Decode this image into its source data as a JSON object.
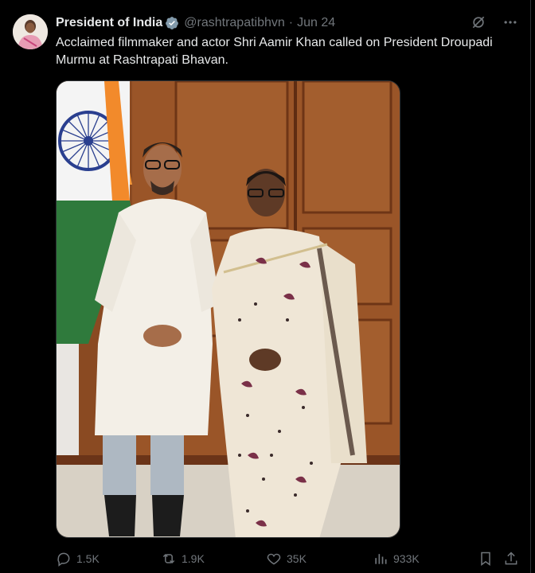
{
  "tweet": {
    "author_name": "President of India",
    "handle": "@rashtrapatibhvn",
    "separator": "·",
    "date": "Jun 24",
    "text": "Acclaimed filmmaker and actor Shri Aamir Khan called on President Droupadi Murmu at Rashtrapati Bhavan."
  },
  "icons": {
    "verified": "verified-badge-icon",
    "grok": "grok-icon",
    "more": "more-icon"
  },
  "actions": {
    "replies": "1.5K",
    "reposts": "1.9K",
    "likes": "35K",
    "views": "933K"
  },
  "colors": {
    "background": "#000000",
    "text_primary": "#e7e9ea",
    "text_secondary": "#71767b",
    "verified_badge": "#829aab",
    "border": "#2f3336"
  }
}
